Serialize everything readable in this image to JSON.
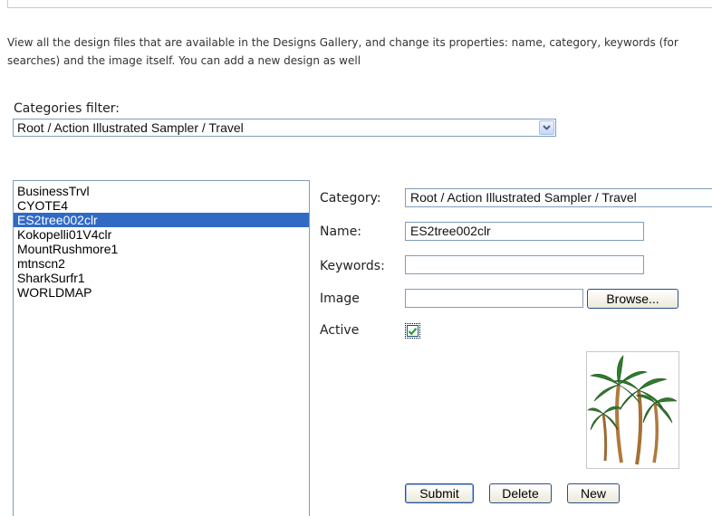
{
  "description": "View all the design files that are available in the Designs Gallery, and change its properties: name, category, keywords (for searches) and the image itself. You can add a new design as well",
  "filter": {
    "label": "Categories filter:",
    "selected": "Root / Action Illustrated Sampler / Travel"
  },
  "designs": {
    "items": [
      "BusinessTrvl",
      "CYOTE4",
      "ES2tree002clr",
      "Kokopelli01V4clr",
      "MountRushmore1",
      "mtnscn2",
      "SharkSurfr1",
      "WORLDMAP"
    ],
    "selected": "ES2tree002clr"
  },
  "form": {
    "category_label": "Category:",
    "category_value": "Root / Action Illustrated Sampler / Travel",
    "name_label": "Name:",
    "name_value": "ES2tree002clr",
    "keywords_label": "Keywords:",
    "keywords_value": "",
    "image_label": "Image",
    "image_value": "",
    "browse_label": "Browse...",
    "active_label": "Active",
    "active_checked": true
  },
  "preview": {
    "icon": "palm-trees-image"
  },
  "buttons": {
    "submit": "Submit",
    "delete": "Delete",
    "new": "New"
  },
  "colors": {
    "selection": "#316ac5",
    "border": "#7f9db9",
    "check": "#21a121"
  }
}
